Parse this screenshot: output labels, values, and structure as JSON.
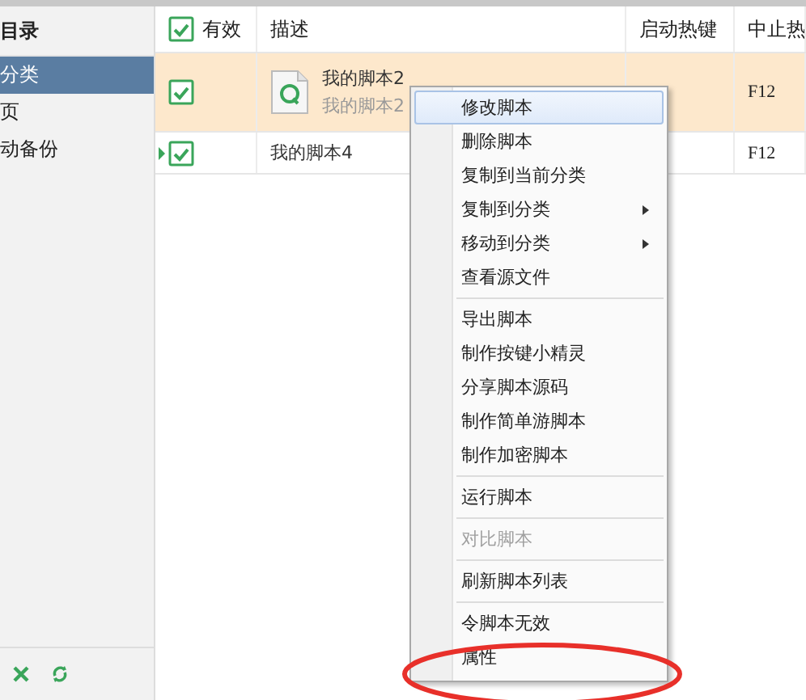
{
  "sidebar": {
    "header": "目录",
    "items": [
      {
        "label": "分类",
        "selected": true
      },
      {
        "label": "页",
        "selected": false
      },
      {
        "label": "动备份",
        "selected": false
      }
    ]
  },
  "table": {
    "columns": [
      {
        "label": "有效",
        "checked": true
      },
      {
        "label": "描述"
      },
      {
        "label": "启动热键"
      },
      {
        "label": "中止热"
      }
    ],
    "rows": [
      {
        "enabled": true,
        "selected": true,
        "current": false,
        "title": "我的脚本2",
        "subtitle": "我的脚本2",
        "has_icon": true,
        "start_hotkey": "",
        "stop_hotkey": "F12"
      },
      {
        "enabled": true,
        "selected": false,
        "current": true,
        "title": "我的脚本4",
        "subtitle": "",
        "has_icon": false,
        "start_hotkey": "",
        "stop_hotkey": "F12"
      }
    ]
  },
  "context_menu": {
    "groups": [
      [
        {
          "label": "修改脚本",
          "highlighted": true,
          "submenu": false,
          "disabled": false
        },
        {
          "label": "删除脚本",
          "highlighted": false,
          "submenu": false,
          "disabled": false
        },
        {
          "label": "复制到当前分类",
          "highlighted": false,
          "submenu": false,
          "disabled": false
        },
        {
          "label": "复制到分类",
          "highlighted": false,
          "submenu": true,
          "disabled": false
        },
        {
          "label": "移动到分类",
          "highlighted": false,
          "submenu": true,
          "disabled": false
        },
        {
          "label": "查看源文件",
          "highlighted": false,
          "submenu": false,
          "disabled": false
        }
      ],
      [
        {
          "label": "导出脚本",
          "highlighted": false,
          "submenu": false,
          "disabled": false
        },
        {
          "label": "制作按键小精灵",
          "highlighted": false,
          "submenu": false,
          "disabled": false
        },
        {
          "label": "分享脚本源码",
          "highlighted": false,
          "submenu": false,
          "disabled": false
        },
        {
          "label": "制作简单游脚本",
          "highlighted": false,
          "submenu": false,
          "disabled": false
        },
        {
          "label": "制作加密脚本",
          "highlighted": false,
          "submenu": false,
          "disabled": false
        }
      ],
      [
        {
          "label": "运行脚本",
          "highlighted": false,
          "submenu": false,
          "disabled": false
        }
      ],
      [
        {
          "label": "对比脚本",
          "highlighted": false,
          "submenu": false,
          "disabled": true
        }
      ],
      [
        {
          "label": "刷新脚本列表",
          "highlighted": false,
          "submenu": false,
          "disabled": false
        }
      ],
      [
        {
          "label": "令脚本无效",
          "highlighted": false,
          "submenu": false,
          "disabled": false
        },
        {
          "label": "属性",
          "highlighted": false,
          "submenu": false,
          "disabled": false
        }
      ]
    ]
  }
}
